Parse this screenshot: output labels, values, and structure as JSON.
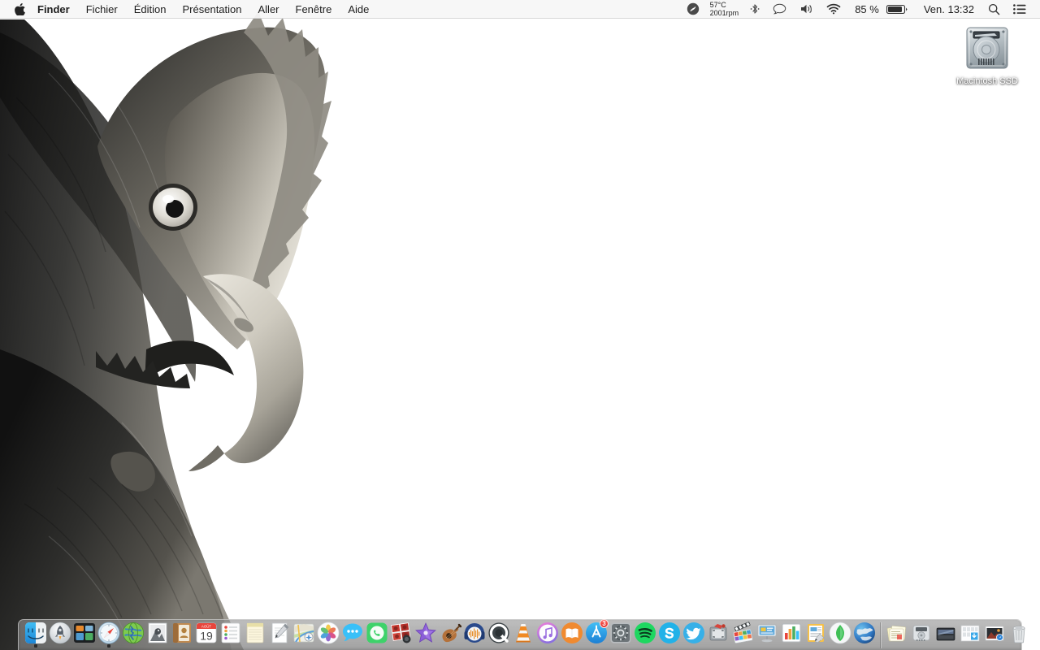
{
  "menubar": {
    "apple_icon": "apple-logo-icon",
    "items": [
      {
        "label": "Finder",
        "bold": true
      },
      {
        "label": "Fichier",
        "bold": false
      },
      {
        "label": "Édition",
        "bold": false
      },
      {
        "label": "Présentation",
        "bold": false
      },
      {
        "label": "Aller",
        "bold": false
      },
      {
        "label": "Fenêtre",
        "bold": false
      },
      {
        "label": "Aide",
        "bold": false
      }
    ],
    "status": {
      "shazam_icon": "shazam-icon",
      "temperature": "57°C",
      "fan_speed": "2001rpm",
      "bluetooth_icon": "bluetooth-icon",
      "messages_icon": "speech-bubble-icon",
      "volume_icon": "volume-icon",
      "wifi_icon": "wifi-icon",
      "battery_percent": "85 %",
      "battery_icon": "battery-icon",
      "datetime": "Ven. 13:32",
      "search_icon": "search-icon",
      "notification_icon": "notification-center-icon"
    }
  },
  "desktop": {
    "icons": [
      {
        "name": "Macintosh SSD",
        "icon": "hard-drive-icon"
      }
    ]
  },
  "dock": {
    "items": [
      {
        "name": "finder",
        "label": "Finder",
        "running": true
      },
      {
        "name": "launchpad",
        "label": "Launchpad",
        "running": false
      },
      {
        "name": "mission-control",
        "label": "Mission Control",
        "running": false
      },
      {
        "name": "safari",
        "label": "Safari",
        "running": true
      },
      {
        "name": "chrome-globe",
        "label": "Navigateur",
        "running": false
      },
      {
        "name": "preview",
        "label": "Aperçu",
        "running": false
      },
      {
        "name": "contacts",
        "label": "Contacts",
        "running": false
      },
      {
        "name": "calendar",
        "label": "Calendrier",
        "running": false,
        "day": "19",
        "month": "AOÛT"
      },
      {
        "name": "reminders",
        "label": "Rappels",
        "running": false
      },
      {
        "name": "notes",
        "label": "Notes",
        "running": false
      },
      {
        "name": "textedit",
        "label": "TextEdit",
        "running": false
      },
      {
        "name": "maps",
        "label": "Plans",
        "running": false
      },
      {
        "name": "photos",
        "label": "Photos",
        "running": false
      },
      {
        "name": "messages",
        "label": "Messages",
        "running": false
      },
      {
        "name": "facetime",
        "label": "FaceTime",
        "running": false
      },
      {
        "name": "photo-booth",
        "label": "Photo Booth",
        "running": false
      },
      {
        "name": "imovie",
        "label": "iMovie",
        "running": false
      },
      {
        "name": "garageband",
        "label": "GarageBand",
        "running": false
      },
      {
        "name": "audacity",
        "label": "Audacity",
        "running": false
      },
      {
        "name": "quicktime",
        "label": "QuickTime Player",
        "running": false
      },
      {
        "name": "vlc",
        "label": "VLC",
        "running": false
      },
      {
        "name": "itunes",
        "label": "iTunes",
        "running": false
      },
      {
        "name": "ibooks",
        "label": "iBooks",
        "running": false
      },
      {
        "name": "app-store",
        "label": "App Store",
        "running": false,
        "badge": "3"
      },
      {
        "name": "system-preferences",
        "label": "Préférences Système",
        "running": false
      },
      {
        "name": "spotify",
        "label": "Spotify",
        "running": false
      },
      {
        "name": "skype",
        "label": "Skype",
        "running": false
      },
      {
        "name": "twitter",
        "label": "Twitter",
        "running": false
      },
      {
        "name": "screenshot-tool",
        "label": "Capture",
        "running": false
      },
      {
        "name": "final-cut-pro",
        "label": "Final Cut Pro",
        "running": false
      },
      {
        "name": "keynote",
        "label": "Keynote",
        "running": false
      },
      {
        "name": "numbers",
        "label": "Numbers",
        "running": false
      },
      {
        "name": "pages",
        "label": "Pages",
        "running": false
      },
      {
        "name": "sims",
        "label": "Les Sims",
        "running": false
      },
      {
        "name": "google-earth",
        "label": "Google Earth",
        "running": false
      }
    ],
    "stacks": [
      {
        "name": "documents-stack",
        "label": "Documents"
      },
      {
        "name": "disk-image-stack",
        "label": "Disque"
      },
      {
        "name": "dark-folder-stack",
        "label": "Dossier"
      },
      {
        "name": "downloads-stack",
        "label": "Téléchargements"
      },
      {
        "name": "images-stack",
        "label": "Images"
      }
    ],
    "trash": {
      "name": "trash",
      "label": "Corbeille"
    }
  }
}
